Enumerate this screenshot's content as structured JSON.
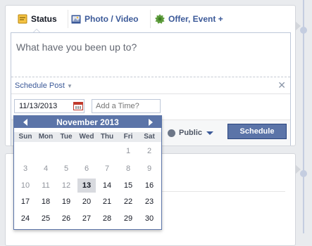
{
  "tabs": [
    {
      "label": "Status",
      "icon": "status-icon"
    },
    {
      "label": "Photo / Video",
      "icon": "photo-icon"
    },
    {
      "label": "Offer, Event +",
      "icon": "offer-icon"
    }
  ],
  "composer": {
    "placeholder": "What have you been up to?",
    "schedule_label": "Schedule Post",
    "date_value": "11/13/2013",
    "time_placeholder": "Add a Time?",
    "audience": "Public",
    "submit_label": "Schedule"
  },
  "calendar": {
    "title": "November 2013",
    "weekdays": [
      "Sun",
      "Mon",
      "Tue",
      "Wed",
      "Thu",
      "Fri",
      "Sat"
    ],
    "weeks": [
      [
        "",
        "",
        "",
        "",
        "",
        "1",
        "2"
      ],
      [
        "3",
        "4",
        "5",
        "6",
        "7",
        "8",
        "9"
      ],
      [
        "10",
        "11",
        "12",
        "13",
        "14",
        "15",
        "16"
      ],
      [
        "17",
        "18",
        "19",
        "20",
        "21",
        "22",
        "23"
      ],
      [
        "24",
        "25",
        "26",
        "27",
        "28",
        "29",
        "30"
      ]
    ],
    "selected_day": "13",
    "past_days": [
      "1",
      "2",
      "3",
      "4",
      "5",
      "6",
      "7",
      "8",
      "9",
      "10",
      "11",
      "12"
    ]
  },
  "colors": {
    "accent": "#3b5998",
    "calendar_header": "#5b74a8",
    "button": "#5b74a8"
  }
}
